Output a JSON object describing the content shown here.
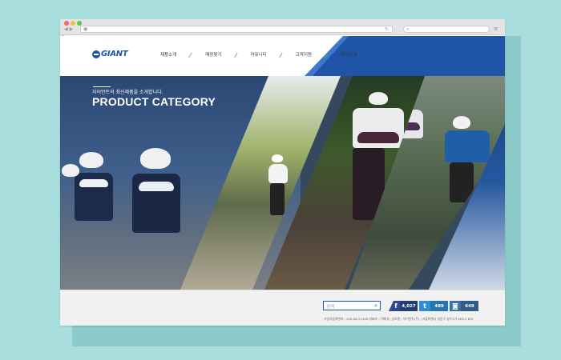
{
  "browser": {
    "fav_label": "즐겨"
  },
  "site": {
    "logo_text": "GIANT",
    "nav": [
      "제품소개",
      "매장찾기",
      "커뮤니티",
      "고객지원",
      "회사소개"
    ],
    "hero": {
      "kicker": "자이언트의 최신제품을 소개합니다.",
      "title": "PRODUCT CATEGORY"
    },
    "footer": {
      "search_placeholder": "검색",
      "sns": [
        {
          "name": "facebook",
          "icon": "f",
          "count": "4,027"
        },
        {
          "name": "twitter",
          "icon": "t",
          "count": "489"
        },
        {
          "name": "instagram",
          "icon": "◙",
          "count": "649"
        }
      ],
      "info": "사업자등록번호 : 206-86-21048  대표자 : 이화대  |  상호명 : 자이언트(주)  |  서울특별시 성동구 성수2가 609-2 B/D"
    }
  },
  "colors": {
    "brand": "#1f54a8",
    "background": "#a8dedd",
    "nav_separator": "#5ab26a"
  }
}
